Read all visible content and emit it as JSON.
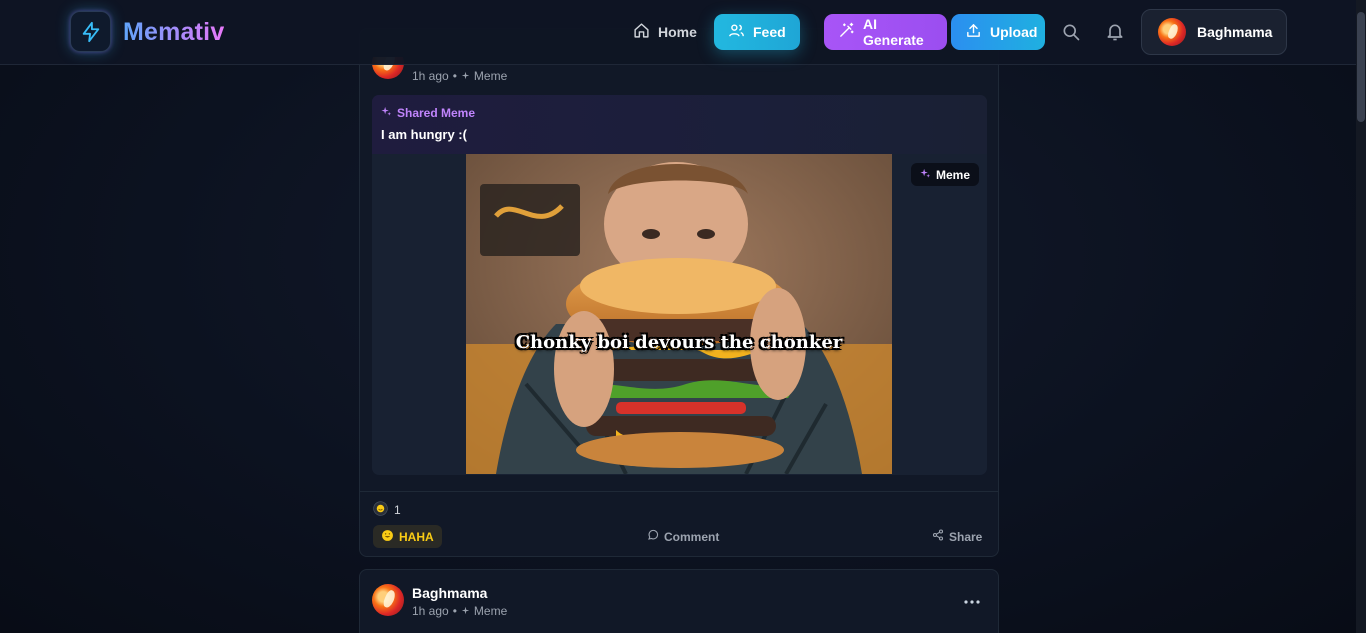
{
  "app": {
    "name": "Memativ"
  },
  "nav": {
    "home": "Home",
    "feed": "Feed",
    "ai_generate": "AI Generate",
    "upload": "Upload"
  },
  "user": {
    "name": "Baghmama"
  },
  "posts": [
    {
      "time": "1h ago",
      "type": "Meme",
      "shared_label": "Shared Meme",
      "shared_title": "I am hungry :(",
      "meme_caption": "Chonky boi devours the chonker",
      "badge": "Meme",
      "reaction_count": "1",
      "reaction_label": "HAHA",
      "comment_label": "Comment",
      "share_label": "Share"
    },
    {
      "author": "Baghmama",
      "time": "1h ago",
      "type": "Meme"
    }
  ],
  "colors": {
    "accent_cyan": "#22b8e0",
    "accent_purple": "#a855f7",
    "accent_blue": "#2b8ff0",
    "reaction_yellow": "#facc15"
  }
}
